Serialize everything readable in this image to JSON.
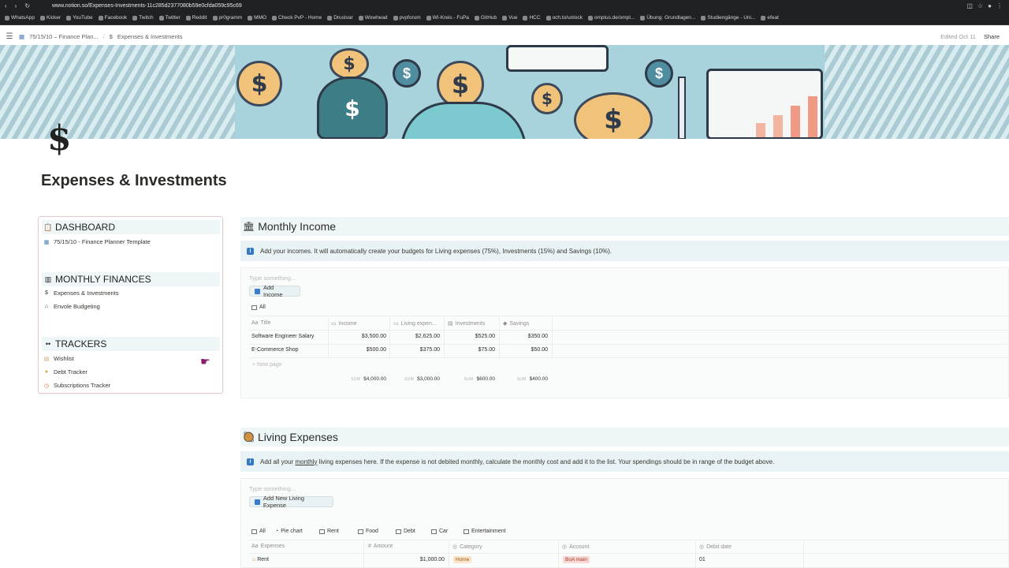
{
  "browser": {
    "url": "www.notion.so/Expenses-Investments-11c285d2377080b59e0cfda059c95c69",
    "bookmarks": [
      "WhatsApp",
      "Kicker",
      "YouTube",
      "Facebook",
      "Twitch",
      "Twitter",
      "Reddit",
      "pr0gramm",
      "MMO",
      "Check PvP - Home",
      "Drustvar",
      "Wowhead",
      "pvpforum",
      "WI-Kreis - FuPa",
      "GitHub",
      "Vue",
      "HCC",
      "och.to/unlock",
      "omplus.de/ompl...",
      "Übung: Grundlagen...",
      "Studiengänge - Uni...",
      "efeat"
    ]
  },
  "topbar": {
    "crumb1": "75/15/10 – Finance Plan...",
    "sep": "/",
    "crumb2": "Expenses & Investments",
    "edited": "Edited Oct 11",
    "share": "Share"
  },
  "page": {
    "icon": "$",
    "title": "Expenses & Investments"
  },
  "sidebar": {
    "dashboard": {
      "title": "DASHBOARD",
      "items": [
        "75/15/10 - Finance Planner Template"
      ]
    },
    "monthly": {
      "title": "MONTHLY FINANCES",
      "items": [
        "Expenses & Investments",
        "Envole Budgeting"
      ]
    },
    "trackers": {
      "title": "TRACKERS",
      "items": [
        "Wishlist",
        "Debt Tracker",
        "Subscriptions Tracker"
      ]
    }
  },
  "income": {
    "title": "Monthly Income",
    "callout": "Add your incomes. It will automatically create your budgets for Living expenses (75%), Investments (15%) and Savings (10%).",
    "placeholder": "Type something...",
    "button": "Add Income",
    "view": "All",
    "columns": [
      "Title",
      "Income",
      "Living expen...",
      "Investments",
      "Savings"
    ],
    "col_prefix": "Aa",
    "rows": [
      [
        "Software Engineer Salary",
        "$3,500.00",
        "$2,625.00",
        "$525.00",
        "$350.00"
      ],
      [
        "E-Commerce Shop",
        "$500.00",
        "$375.00",
        "$75.00",
        "$50.00"
      ]
    ],
    "new_page": "New page",
    "sum_label": "SUM",
    "sums": [
      "$4,000.00",
      "$3,000.00",
      "$600.00",
      "$400.00"
    ]
  },
  "living": {
    "title": "Living Expenses",
    "callout_a": "Add all your",
    "callout_link": "monthly",
    "callout_b": "living expenses here. If the expense is not debited monthly, calculate the monthly cost and add it to the list. Your spendings should be in range of the budget above.",
    "placeholder": "Type something...",
    "button": "Add New Living Expense",
    "tabs": [
      "All",
      "Pie chart",
      "Rent",
      "Food",
      "Debt",
      "Car",
      "Entertainment"
    ],
    "columns": [
      "Expenses",
      "Amount",
      "Category",
      "Account",
      "Debit date"
    ],
    "col_prefix": "Aa",
    "row": [
      "Rent",
      "$1,000.00",
      "Home",
      "BoA main",
      "01"
    ]
  }
}
